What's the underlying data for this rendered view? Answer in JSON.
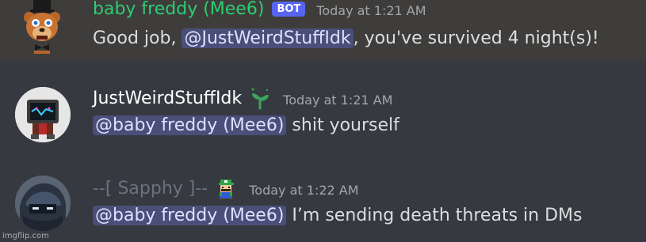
{
  "messages": [
    {
      "username": "baby freddy (Mee6)",
      "bot_tag": "BOT",
      "timestamp": "Today at 1:21 AM",
      "content_before": "Good job, ",
      "mention": "@JustWeirdStuffIdk",
      "content_after": ", you've survived 4 night(s)!",
      "username_color": "#2ecc71",
      "highlighted": true
    },
    {
      "username": "JustWeirdStuffIdk",
      "timestamp": "Today at 1:21 AM",
      "mention": "@baby freddy (Mee6)",
      "content_after": " shit yourself",
      "username_color": "#ffffff",
      "badge_icon": "sprout-icon"
    },
    {
      "username": "--[ Sapphy ]--",
      "timestamp": "Today at 1:22 AM",
      "mention": "@baby freddy (Mee6)",
      "content_after": " I’m sending death threats in DMs",
      "username_color": "#6b7280",
      "badge_icon": "luigi-icon"
    }
  ],
  "watermark": "imgflip.com",
  "colors": {
    "background": "#36393f",
    "highlight_background": "#3e3d3b",
    "mention_background": "#4a4f7a",
    "bot_tag": "#5865f2"
  }
}
